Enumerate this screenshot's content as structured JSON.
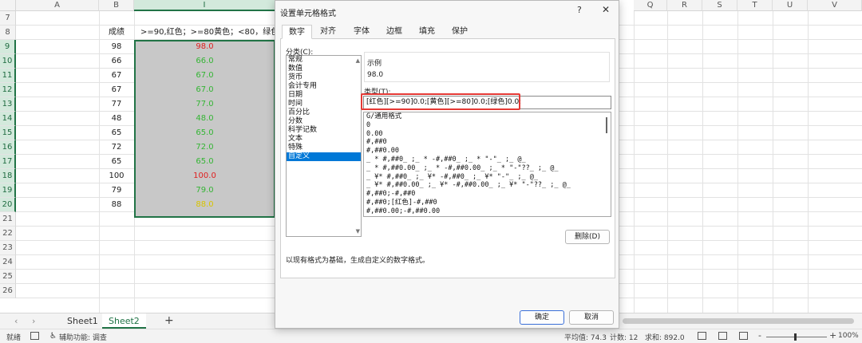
{
  "sheet": {
    "columns": [
      "A",
      "B",
      "I",
      "Q",
      "R",
      "S",
      "T",
      "U",
      "V"
    ],
    "rows": [
      "7",
      "8",
      "9",
      "10",
      "11",
      "12",
      "13",
      "14",
      "15",
      "16",
      "17",
      "18",
      "19",
      "20",
      "21",
      "22",
      "23",
      "24",
      "25",
      "26"
    ],
    "header_b": "成绩",
    "header_i": ">=90,红色；>=80黄色；<80，绿色",
    "scores": [
      "98",
      "66",
      "67",
      "67",
      "77",
      "48",
      "65",
      "72",
      "65",
      "100",
      "79",
      "88"
    ],
    "formatted": [
      "98.0",
      "66.0",
      "67.0",
      "67.0",
      "77.0",
      "48.0",
      "65.0",
      "72.0",
      "65.0",
      "100.0",
      "79.0",
      "88.0"
    ],
    "formatted_colors": [
      "red",
      "green",
      "green",
      "green",
      "green",
      "green",
      "green",
      "green",
      "green",
      "red",
      "green",
      "yellow"
    ]
  },
  "tabs_bar": {
    "prev": "‹",
    "next": "›",
    "sheets": [
      "Sheet1",
      "Sheet2"
    ],
    "active_sheet": "Sheet2",
    "add": "+"
  },
  "status": {
    "ready": "就绪",
    "accessibility": "辅助功能: 调查",
    "average": "平均值: 74.3",
    "count": "计数: 12",
    "sum": "求和: 892.0",
    "zoom_minus": "-",
    "zoom_plus": "+",
    "zoom": "100%"
  },
  "dialog": {
    "title": "设置单元格格式",
    "help": "?",
    "close": "✕",
    "tabs": [
      "数字",
      "对齐",
      "字体",
      "边框",
      "填充",
      "保护"
    ],
    "active_tab": "数字",
    "category_label": "分类(C):",
    "categories": [
      "常规",
      "数值",
      "货币",
      "会计专用",
      "日期",
      "时间",
      "百分比",
      "分数",
      "科学记数",
      "文本",
      "特殊",
      "自定义"
    ],
    "selected_category": "自定义",
    "sample_label": "示例",
    "sample_value": "98.0",
    "type_label": "类型(T):",
    "type_value": "[红色][>=90]0.0;[黄色][>=80]0.0;[绿色]0.0;",
    "formats": [
      "G/通用格式",
      "0",
      "0.00",
      "#,##0",
      "#,##0.00",
      "_ * #,##0_ ;_ * -#,##0_ ;_ * \"-\"_ ;_ @_",
      "_ * #,##0.00_ ;_ * -#,##0.00_ ;_ * \"-\"??_ ;_ @_",
      "_ ¥* #,##0_ ;_ ¥* -#,##0_ ;_ ¥* \"-\"_ ;_ @_",
      "_ ¥* #,##0.00_ ;_ ¥* -#,##0.00_ ;_ ¥* \"-\"??_ ;_ @_",
      "#,##0;-#,##0",
      "#,##0;[红色]-#,##0",
      "#,##0.00;-#,##0.00"
    ],
    "delete_button": "删除(D)",
    "description": "以现有格式为基础，生成自定义的数字格式。",
    "ok_button": "确定",
    "cancel_button": "取消",
    "colors": {
      "red": "#e02020",
      "green": "#34b534",
      "yellow": "#d8c400",
      "accent": "#217346",
      "selection": "#0078d7"
    }
  }
}
